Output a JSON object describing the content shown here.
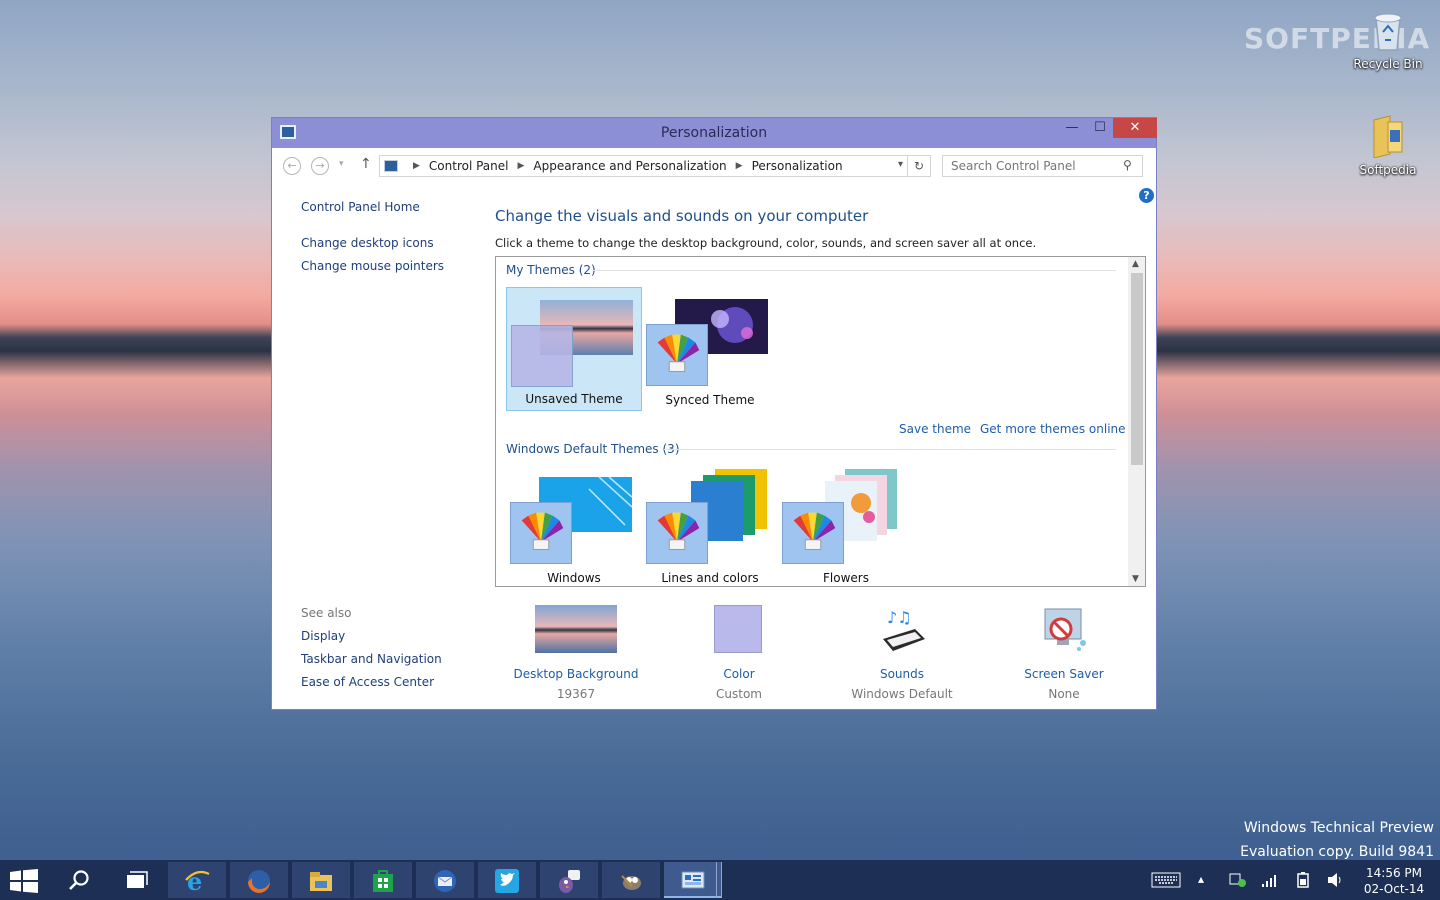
{
  "desktop": {
    "watermark_brand": "SOFTPEDIA",
    "icons": [
      {
        "label": "Recycle Bin",
        "icon": "recycle-bin-icon"
      },
      {
        "label": "Softpedia",
        "icon": "folder-icon"
      }
    ],
    "build_line1": "Windows Technical Preview",
    "build_line2": "Evaluation copy. Build 9841"
  },
  "window": {
    "title": "Personalization",
    "controls": {
      "minimize": "—",
      "maximize": "☐",
      "close": "✕"
    }
  },
  "address": {
    "crumbs": [
      "Control Panel",
      "Appearance and Personalization",
      "Personalization"
    ],
    "search_placeholder": "Search Control Panel"
  },
  "sidebar": {
    "home": "Control Panel Home",
    "links": [
      "Change desktop icons",
      "Change mouse pointers"
    ],
    "see_also_label": "See also",
    "see_also": [
      "Display",
      "Taskbar and Navigation",
      "Ease of Access Center"
    ]
  },
  "main": {
    "heading": "Change the visuals and sounds on your computer",
    "subtext": "Click a theme to change the desktop background, color, sounds, and screen saver all at once."
  },
  "gallery": {
    "my_themes_label": "My Themes (2)",
    "my_themes": [
      {
        "label": "Unsaved Theme",
        "selected": true
      },
      {
        "label": "Synced Theme",
        "selected": false
      }
    ],
    "save_theme": "Save theme",
    "get_more": "Get more themes online",
    "default_label": "Windows Default Themes (3)",
    "default_themes": [
      {
        "label": "Windows"
      },
      {
        "label": "Lines and colors"
      },
      {
        "label": "Flowers"
      }
    ]
  },
  "options": [
    {
      "title": "Desktop Background",
      "sub": "19367"
    },
    {
      "title": "Color",
      "sub": "Custom"
    },
    {
      "title": "Sounds",
      "sub": "Windows Default"
    },
    {
      "title": "Screen Saver",
      "sub": "None"
    }
  ],
  "taskbar": {
    "clock_time": "14:56 PM",
    "clock_date": "02-Oct-14"
  },
  "colors": {
    "accent_title": "#8d8fd6",
    "link": "#1f5da8",
    "close": "#c74646",
    "taskbar": "#1e2f56"
  }
}
